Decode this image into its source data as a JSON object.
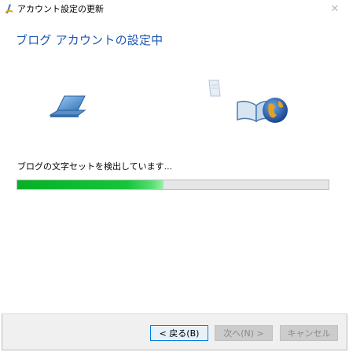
{
  "window": {
    "title": "アカウント設定の更新",
    "close_glyph": "✕"
  },
  "main": {
    "heading": "ブログ アカウントの設定中",
    "status_text": "ブログの文字セットを検出しています...",
    "progress_fraction": 0.47
  },
  "icons": {
    "title": "writer-app-icon",
    "laptop": "laptop-icon",
    "document": "document-icon",
    "globe": "book-globe-icon"
  },
  "footer": {
    "back_label": "< 戻る(B)",
    "next_label": "次へ(N) >",
    "cancel_label": "キャンセル"
  },
  "colors": {
    "heading": "#1e58b4",
    "progress": "#06b025",
    "accent_border": "#0078d7"
  }
}
